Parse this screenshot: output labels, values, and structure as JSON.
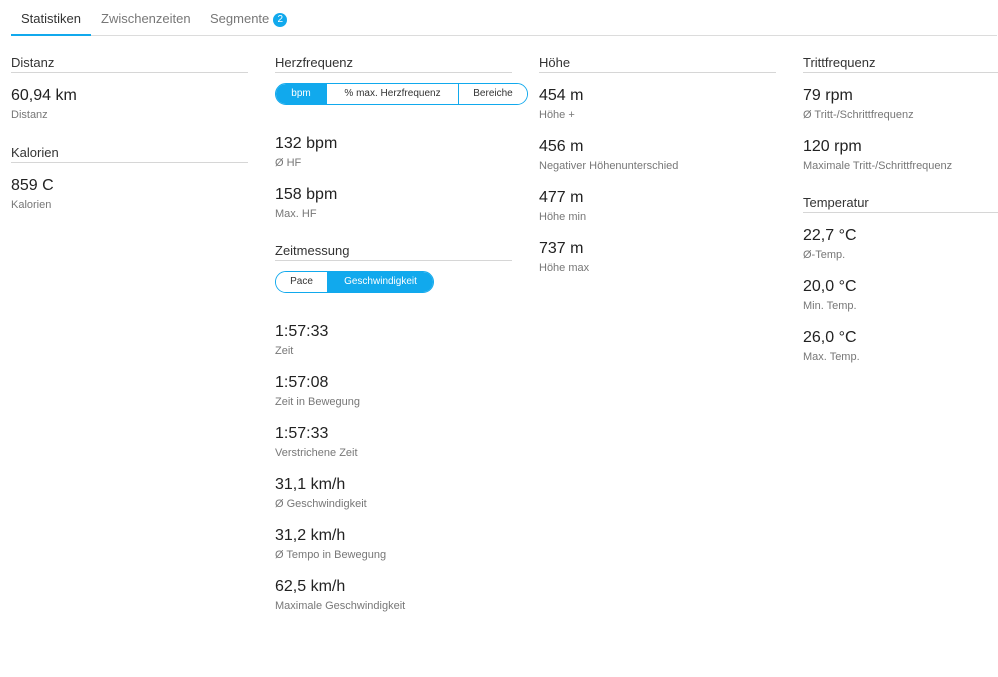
{
  "tabs": [
    {
      "label": "Statistiken"
    },
    {
      "label": "Zwischenzeiten"
    },
    {
      "label": "Segmente",
      "badge": "2"
    }
  ],
  "distanz": {
    "title": "Distanz",
    "stats": [
      {
        "value": "60,94 km",
        "label": "Distanz"
      }
    ]
  },
  "kalorien": {
    "title": "Kalorien",
    "stats": [
      {
        "value": "859 C",
        "label": "Kalorien"
      }
    ]
  },
  "herzfrequenz": {
    "title": "Herzfrequenz",
    "toggle": [
      "bpm",
      "% max. Herzfrequenz",
      "Bereiche"
    ],
    "stats": [
      {
        "value": "132 bpm",
        "label": "Ø HF"
      },
      {
        "value": "158 bpm",
        "label": "Max. HF"
      }
    ]
  },
  "zeitmessung": {
    "title": "Zeitmessung",
    "toggle": [
      "Pace",
      "Geschwindigkeit"
    ],
    "stats": [
      {
        "value": "1:57:33",
        "label": "Zeit"
      },
      {
        "value": "1:57:08",
        "label": "Zeit in Bewegung"
      },
      {
        "value": "1:57:33",
        "label": "Verstrichene Zeit"
      },
      {
        "value": "31,1 km/h",
        "label": "Ø Geschwindigkeit"
      },
      {
        "value": "31,2 km/h",
        "label": "Ø Tempo in Bewegung"
      },
      {
        "value": "62,5 km/h",
        "label": "Maximale Geschwindigkeit"
      }
    ]
  },
  "hoehe": {
    "title": "Höhe",
    "stats": [
      {
        "value": "454 m",
        "label": "Höhe +"
      },
      {
        "value": "456 m",
        "label": "Negativer Höhenunterschied"
      },
      {
        "value": "477 m",
        "label": "Höhe min"
      },
      {
        "value": "737 m",
        "label": "Höhe max"
      }
    ]
  },
  "trittfrequenz": {
    "title": "Trittfrequenz",
    "stats": [
      {
        "value": "79 rpm",
        "label": "Ø Tritt-/Schrittfrequenz"
      },
      {
        "value": "120 rpm",
        "label": "Maximale Tritt-/Schrittfrequenz"
      }
    ]
  },
  "temperatur": {
    "title": "Temperatur",
    "stats": [
      {
        "value": "22,7 °C",
        "label": "Ø-Temp."
      },
      {
        "value": "20,0 °C",
        "label": "Min. Temp."
      },
      {
        "value": "26,0 °C",
        "label": "Max. Temp."
      }
    ]
  },
  "colors": {
    "accent": "#11a9ed"
  }
}
